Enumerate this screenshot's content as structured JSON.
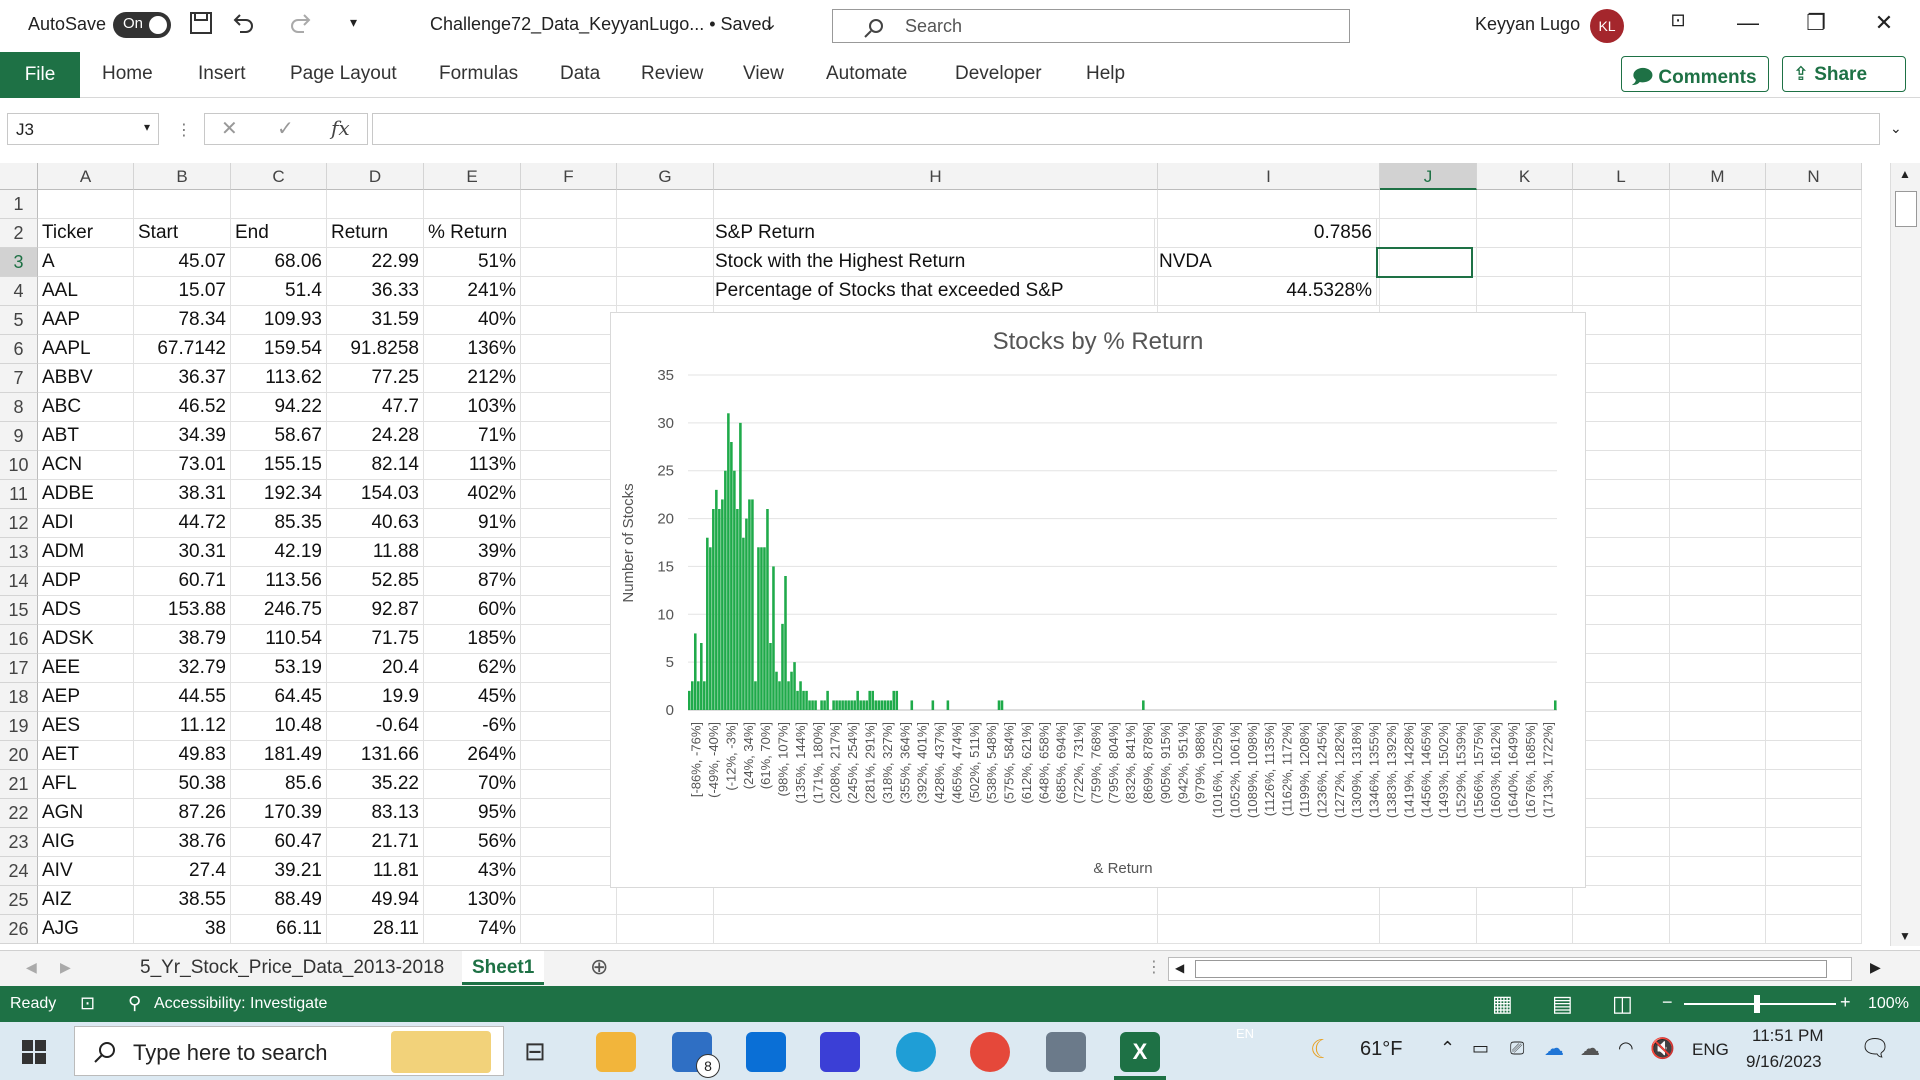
{
  "titlebar": {
    "autosave_label": "AutoSave",
    "autosave_state": "On",
    "filename": "Challenge72_Data_KeyyanLugo... • Saved",
    "search_placeholder": "Search",
    "user_name": "Keyyan Lugo",
    "user_initials": "KL"
  },
  "ribbon": {
    "tabs": [
      "File",
      "Home",
      "Insert",
      "Page Layout",
      "Formulas",
      "Data",
      "Review",
      "View",
      "Automate",
      "Developer",
      "Help"
    ],
    "comments_label": "Comments",
    "share_label": "Share"
  },
  "formula_bar": {
    "name_box": "J3",
    "fx_label": "fx",
    "formula": ""
  },
  "columns": [
    "A",
    "B",
    "C",
    "D",
    "E",
    "F",
    "G",
    "H",
    "I",
    "J",
    "K",
    "L",
    "M",
    "N"
  ],
  "selected_column": "J",
  "rows": [
    "1",
    "2",
    "3",
    "4",
    "5",
    "6",
    "7",
    "8",
    "9",
    "10",
    "11",
    "12",
    "13",
    "14",
    "15",
    "16",
    "17",
    "18",
    "19",
    "20",
    "21",
    "22",
    "23",
    "24",
    "25",
    "26"
  ],
  "table_header": [
    "Ticker",
    "Start",
    "End",
    "Return",
    "% Return"
  ],
  "table_rows": [
    [
      "A",
      "45.07",
      "68.06",
      "22.99",
      "51%"
    ],
    [
      "AAL",
      "15.07",
      "51.4",
      "36.33",
      "241%"
    ],
    [
      "AAP",
      "78.34",
      "109.93",
      "31.59",
      "40%"
    ],
    [
      "AAPL",
      "67.7142",
      "159.54",
      "91.8258",
      "136%"
    ],
    [
      "ABBV",
      "36.37",
      "113.62",
      "77.25",
      "212%"
    ],
    [
      "ABC",
      "46.52",
      "94.22",
      "47.7",
      "103%"
    ],
    [
      "ABT",
      "34.39",
      "58.67",
      "24.28",
      "71%"
    ],
    [
      "ACN",
      "73.01",
      "155.15",
      "82.14",
      "113%"
    ],
    [
      "ADBE",
      "38.31",
      "192.34",
      "154.03",
      "402%"
    ],
    [
      "ADI",
      "44.72",
      "85.35",
      "40.63",
      "91%"
    ],
    [
      "ADM",
      "30.31",
      "42.19",
      "11.88",
      "39%"
    ],
    [
      "ADP",
      "60.71",
      "113.56",
      "52.85",
      "87%"
    ],
    [
      "ADS",
      "153.88",
      "246.75",
      "92.87",
      "60%"
    ],
    [
      "ADSK",
      "38.79",
      "110.54",
      "71.75",
      "185%"
    ],
    [
      "AEE",
      "32.79",
      "53.19",
      "20.4",
      "62%"
    ],
    [
      "AEP",
      "44.55",
      "64.45",
      "19.9",
      "45%"
    ],
    [
      "AES",
      "11.12",
      "10.48",
      "-0.64",
      "-6%"
    ],
    [
      "AET",
      "49.83",
      "181.49",
      "131.66",
      "264%"
    ],
    [
      "AFL",
      "50.38",
      "85.6",
      "35.22",
      "70%"
    ],
    [
      "AGN",
      "87.26",
      "170.39",
      "83.13",
      "95%"
    ],
    [
      "AIG",
      "38.76",
      "60.47",
      "21.71",
      "56%"
    ],
    [
      "AIV",
      "27.4",
      "39.21",
      "11.81",
      "43%"
    ],
    [
      "AIZ",
      "38.55",
      "88.49",
      "49.94",
      "130%"
    ],
    [
      "AJG",
      "38",
      "66.11",
      "28.11",
      "74%"
    ]
  ],
  "summary": {
    "sp_label": "S&P Return",
    "sp_value": "0.7856",
    "highest_label": "Stock with the Highest Return",
    "highest_value": "NVDA",
    "exceeded_label": "Percentage of Stocks that exceeded S&P",
    "exceeded_value": "44.5328%"
  },
  "chart_data": {
    "type": "bar",
    "title": "Stocks by % Return",
    "xlabel": "& Return",
    "ylabel": "Number of Stocks",
    "ylim": [
      0,
      35
    ],
    "yticks": [
      0,
      5,
      10,
      15,
      20,
      25,
      30,
      35
    ],
    "grid": true,
    "color": "#1faa4a",
    "labels": [
      "[-86%, -76%]",
      "(-49%, -40%]",
      "(-12%, -3%]",
      "(24%, 34%]",
      "(61%, 70%]",
      "(98%, 107%]",
      "(135%, 144%]",
      "(171%, 180%]",
      "(208%, 217%]",
      "(245%, 254%]",
      "(281%, 291%]",
      "(318%, 327%]",
      "(355%, 364%]",
      "(392%, 401%]",
      "(428%, 437%]",
      "(465%, 474%]",
      "(502%, 511%]",
      "(538%, 548%]",
      "(575%, 584%]",
      "(612%, 621%]",
      "(648%, 658%]",
      "(685%, 694%]",
      "(722%, 731%]",
      "(759%, 768%]",
      "(795%, 804%]",
      "(832%, 841%]",
      "(869%, 878%]",
      "(905%, 915%]",
      "(942%, 951%]",
      "(979%, 988%]",
      "(1016%, 1025%]",
      "(1052%, 1061%]",
      "(1089%, 1098%]",
      "(1126%, 1135%]",
      "(1162%, 1172%]",
      "(1199%, 1208%]",
      "(1236%, 1245%]",
      "(1272%, 1282%]",
      "(1309%, 1318%]",
      "(1346%, 1355%]",
      "(1383%, 1392%]",
      "(1419%, 1428%]",
      "(1456%, 1465%]",
      "(1493%, 1502%]",
      "(1529%, 1539%]",
      "(1566%, 1575%]",
      "(1603%, 1612%]",
      "(1640%, 1649%]",
      "(1676%, 1685%]",
      "(1713%, 1722%]"
    ],
    "values": [
      2,
      3,
      8,
      3,
      7,
      3,
      18,
      17,
      21,
      23,
      21,
      22,
      25,
      31,
      28,
      25,
      21,
      30,
      18,
      20,
      22,
      22,
      3,
      17,
      17,
      17,
      21,
      7,
      15,
      4,
      3,
      9,
      14,
      3,
      4,
      5,
      2,
      3,
      2,
      2,
      1,
      1,
      1,
      0,
      1,
      1,
      2,
      0,
      1,
      1,
      1,
      1,
      1,
      1,
      1,
      1,
      2,
      1,
      1,
      1,
      2,
      2,
      1,
      1,
      1,
      1,
      1,
      1,
      2,
      2,
      0,
      0,
      0,
      0,
      1,
      0,
      0,
      0,
      0,
      0,
      0,
      1,
      0,
      0,
      0,
      0,
      1,
      0,
      0,
      0,
      0,
      0,
      0,
      0,
      0,
      0,
      0,
      0,
      0,
      0,
      0,
      0,
      0,
      1,
      1,
      0,
      0,
      0,
      0,
      0,
      0,
      0,
      0,
      0,
      0,
      0,
      0,
      0,
      0,
      0,
      0,
      0,
      0,
      0,
      0,
      0,
      0,
      0,
      0,
      0,
      0,
      0,
      0,
      0,
      0,
      0,
      0,
      0,
      0,
      0,
      0,
      0,
      0,
      0,
      0,
      0,
      0,
      0,
      0,
      0,
      0,
      1,
      0,
      0,
      0,
      0,
      0,
      0,
      0,
      0,
      0,
      0,
      0,
      0,
      0,
      0,
      0,
      0,
      0,
      0,
      0,
      0,
      0,
      0,
      0,
      0,
      0,
      0,
      0,
      0,
      0,
      0,
      0,
      0,
      0,
      0,
      0,
      0,
      0,
      0,
      0,
      0,
      0,
      0,
      0,
      0,
      0,
      0,
      0,
      0,
      0,
      0,
      0,
      0,
      0,
      0,
      0,
      0,
      0,
      0,
      0,
      0,
      0,
      0,
      0,
      0,
      0,
      0,
      0,
      0,
      0,
      0,
      0,
      0,
      0,
      0,
      0,
      0,
      0,
      0,
      0,
      0,
      0,
      0,
      0,
      0,
      0,
      0,
      0,
      0,
      0,
      0,
      0,
      0,
      0,
      0,
      0,
      0,
      0,
      0,
      0,
      0,
      0,
      0,
      0,
      0,
      0,
      0,
      0,
      0,
      0,
      0,
      0,
      0,
      0,
      0,
      0,
      0,
      0,
      0,
      0,
      0,
      0,
      0,
      0,
      0,
      0,
      0,
      0,
      0,
      0,
      0,
      0,
      0,
      0,
      0,
      0,
      0,
      1
    ]
  },
  "sheets": [
    "5_Yr_Stock_Price_Data_2013-2018",
    "Sheet1"
  ],
  "active_sheet": "Sheet1",
  "status": {
    "ready": "Ready",
    "accessibility": "Accessibility: Investigate",
    "zoom": "100%"
  },
  "taskbar": {
    "search_placeholder": "Type here to search",
    "mail_badge": "8",
    "weather": "61°F",
    "language": "ENG",
    "input_indicator": "EN",
    "time": "11:51 PM",
    "date": "9/16/2023"
  },
  "colors": {
    "excel_green": "#1e7145",
    "bar_green": "#1faa4a",
    "avatar_red": "#a4262c"
  }
}
